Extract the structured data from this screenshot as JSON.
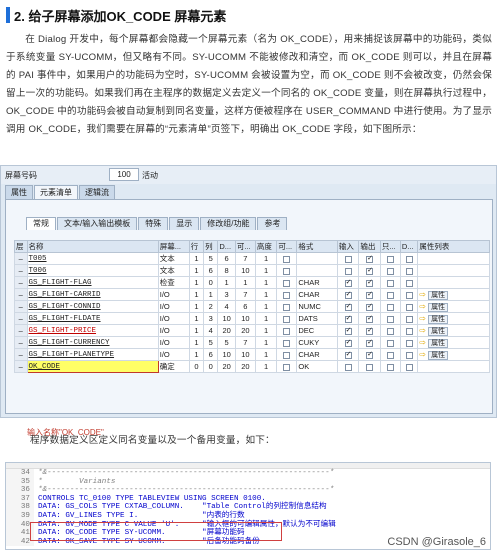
{
  "heading": "2. 给子屏幕添加OK_CODE 屏幕元素",
  "paragraph": "在 Dialog 开发中，每个屏幕都会隐藏一个屏幕元素（名为 OK_CODE），用来捕捉该屏幕中的功能码，类似于系统变量 SY-UCOMM，但又略有不同。SY-UCOMM 不能被修改和清空，而 OK_CODE 则可以，并且在屏幕的 PAI 事件中，如果用户的功能码为空时，SY-UCOMM 会被设置为空，而 OK_CODE 则不会被改变，仍然会保留上一次的功能码。如果我们再在主程序的数据定义去定义一个同名的 OK_CODE 变量，则在屏幕执行过程中，OK_CODE 中的功能码会被自动复制到同名变量，这样方便被程序在 USER_COMMAND 中进行使用。为了显示调用 OK_CODE，我们需要在屏幕的“元素清单”页签下，明确出 OK_CODE 字段，如下图所示：",
  "sap": {
    "screen_label": "屏幕号码",
    "screen_no": "100",
    "state": "活动",
    "main_tabs": [
      "属性",
      "元素清单",
      "逻辑流"
    ],
    "sub_tabs": [
      "常规",
      "文本/输入输出模板",
      "特殊",
      "显示",
      "修改组/功能",
      "参考"
    ],
    "headers": [
      "层",
      "名称",
      "屏幕...",
      "行",
      "列",
      "D...",
      "可...",
      "高度",
      "可...",
      "格式",
      "输入",
      "输出",
      "只...",
      "D...",
      "属性列表"
    ],
    "rows": [
      {
        "name": "T005",
        "type": "文本",
        "row": "1",
        "col": "5",
        "d": "6",
        "v": "7",
        "h": "1",
        "fmt": "",
        "inp": false,
        "out": true,
        "red": false,
        "btn": false
      },
      {
        "name": "T006",
        "type": "文本",
        "row": "1",
        "col": "6",
        "d": "8",
        "v": "10",
        "h": "1",
        "fmt": "",
        "inp": false,
        "out": true,
        "red": false,
        "btn": false
      },
      {
        "name": "GS_FLIGHT-FLAG",
        "type": "检查",
        "row": "1",
        "col": "0",
        "d": "1",
        "v": "1",
        "h": "1",
        "fmt": "CHAR",
        "inp": true,
        "out": true,
        "red": false,
        "btn": false
      },
      {
        "name": "GS_FLIGHT-CARRID",
        "type": "I/O",
        "row": "1",
        "col": "1",
        "d": "3",
        "v": "7",
        "h": "1",
        "fmt": "CHAR",
        "inp": true,
        "out": true,
        "red": false,
        "btn": true
      },
      {
        "name": "GS_FLIGHT-CONNID",
        "type": "I/O",
        "row": "1",
        "col": "2",
        "d": "4",
        "v": "6",
        "h": "1",
        "fmt": "NUMC",
        "inp": true,
        "out": true,
        "red": false,
        "btn": true
      },
      {
        "name": "GS_FLIGHT-FLDATE",
        "type": "I/O",
        "row": "1",
        "col": "3",
        "d": "10",
        "v": "10",
        "h": "1",
        "fmt": "DATS",
        "inp": true,
        "out": true,
        "red": false,
        "btn": true
      },
      {
        "name": "GS_FLIGHT-PRICE",
        "type": "I/O",
        "row": "1",
        "col": "4",
        "d": "20",
        "v": "20",
        "h": "1",
        "fmt": "DEC",
        "inp": true,
        "out": true,
        "red": true,
        "btn": true
      },
      {
        "name": "GS_FLIGHT-CURRENCY",
        "type": "I/O",
        "row": "1",
        "col": "5",
        "d": "5",
        "v": "7",
        "h": "1",
        "fmt": "CUKY",
        "inp": true,
        "out": true,
        "red": false,
        "btn": true
      },
      {
        "name": "GS_FLIGHT-PLANETYPE",
        "type": "I/O",
        "row": "1",
        "col": "6",
        "d": "10",
        "v": "10",
        "h": "1",
        "fmt": "CHAR",
        "inp": true,
        "out": true,
        "red": false,
        "btn": true
      },
      {
        "name": "OK_CODE",
        "type": "确定",
        "row": "0",
        "col": "0",
        "d": "20",
        "v": "20",
        "h": "1",
        "fmt": "OK",
        "inp": false,
        "out": false,
        "red": false,
        "btn": false
      }
    ],
    "attr_label": "属性",
    "note": "输入名称\"OK_CODE\""
  },
  "paragraph2": "程序数据定义区定义同名变量以及一个备用变量，如下：",
  "code": {
    "lines": [
      {
        "n": "34",
        "t": "*&--------------------------------------------------------------*"
      },
      {
        "n": "35",
        "t": "*        Variants"
      },
      {
        "n": "36",
        "t": "*&--------------------------------------------------------------*"
      },
      {
        "n": "37",
        "t": "CONTROLS TC_0100 TYPE TABLEVIEW USING SCREEN 0100."
      },
      {
        "n": "38",
        "t": "DATA: GS_COLS TYPE CXTAB_COLUMN.    \"Table Control的列控制信息结构"
      },
      {
        "n": "39",
        "t": "DATA: GV_LINES TYPE I.              \"内表的行数"
      },
      {
        "n": "40",
        "t": "DATA: GV_MODE TYPE C VALUE 'U'.     \"输入框的可编辑属性，默认为不可编辑"
      },
      {
        "n": "41",
        "t": "DATA: OK_CODE TYPE SY-UCOMM.        \"屏幕功能码"
      },
      {
        "n": "42",
        "t": "DATA: OK_SAVE TYPE SY-UCOMM.        \"后备功能码备份"
      }
    ],
    "watermark": "CSDN @Girasole_6"
  }
}
